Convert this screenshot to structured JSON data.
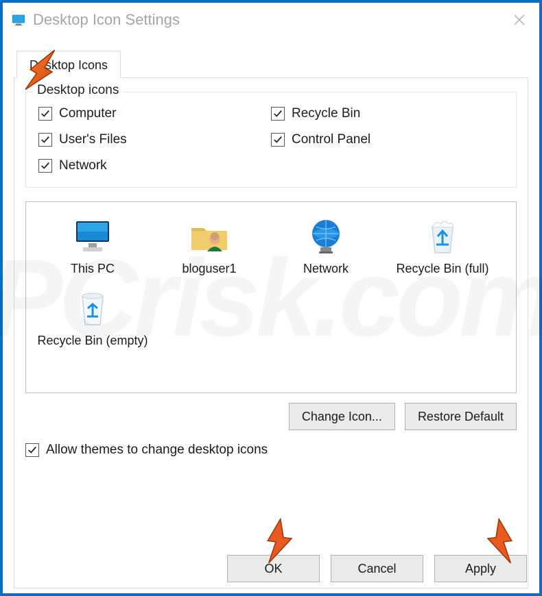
{
  "window": {
    "title": "Desktop Icon Settings"
  },
  "tab": {
    "label": "Desktop Icons"
  },
  "group": {
    "label": "Desktop icons",
    "checkboxes": {
      "computer": "Computer",
      "users_files": "User's Files",
      "network": "Network",
      "recycle_bin": "Recycle Bin",
      "control_panel": "Control Panel"
    }
  },
  "icons": {
    "this_pc": "This PC",
    "user": "bloguser1",
    "network": "Network",
    "recycle_full": "Recycle Bin (full)",
    "recycle_empty": "Recycle Bin (empty)"
  },
  "buttons": {
    "change_icon": "Change Icon...",
    "restore_default": "Restore Default",
    "ok": "OK",
    "cancel": "Cancel",
    "apply": "Apply"
  },
  "allow_themes": "Allow themes to change desktop icons",
  "watermark": "PCrisk.com"
}
